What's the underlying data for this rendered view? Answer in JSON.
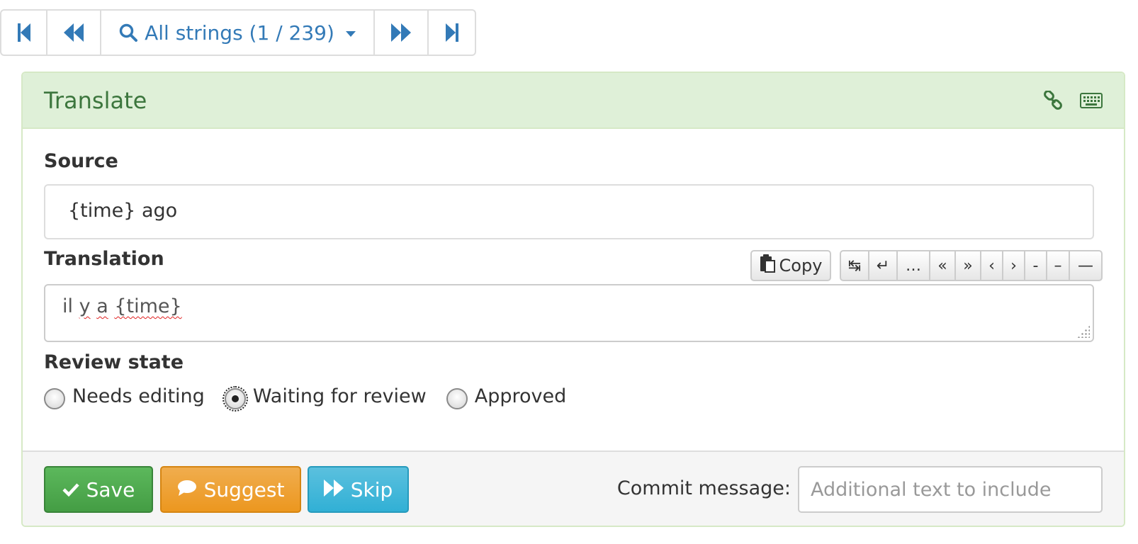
{
  "nav": {
    "first_icon": "skip-first-icon",
    "prev_icon": "step-backward-icon",
    "search_label": "All strings (1 / 239)",
    "next_icon": "step-forward-icon",
    "last_icon": "skip-last-icon"
  },
  "panel": {
    "title": "Translate",
    "link_icon": "link-icon",
    "keyboard_icon": "keyboard-icon"
  },
  "source": {
    "label": "Source",
    "text": "{time} ago"
  },
  "translation": {
    "label": "Translation",
    "copy_label": "Copy",
    "special_chars": [
      "↹",
      "↵",
      "…",
      "«",
      "»",
      "‹",
      "›",
      "-",
      "–",
      "—"
    ],
    "words": [
      "il",
      "y",
      "a",
      "{time}"
    ]
  },
  "review": {
    "label": "Review state",
    "options": [
      "Needs editing",
      "Waiting for review",
      "Approved"
    ],
    "selected": "Waiting for review"
  },
  "footer": {
    "save_label": "Save",
    "suggest_label": "Suggest",
    "skip_label": "Skip",
    "commit_label": "Commit message:",
    "commit_placeholder": "Additional text to include"
  },
  "colors": {
    "link": "#337ab7",
    "panel_heading_bg": "#dff0d8",
    "panel_heading_text": "#3c763d",
    "save": "#5cb85c",
    "suggest": "#f0ad4e",
    "skip": "#5bc0de"
  }
}
